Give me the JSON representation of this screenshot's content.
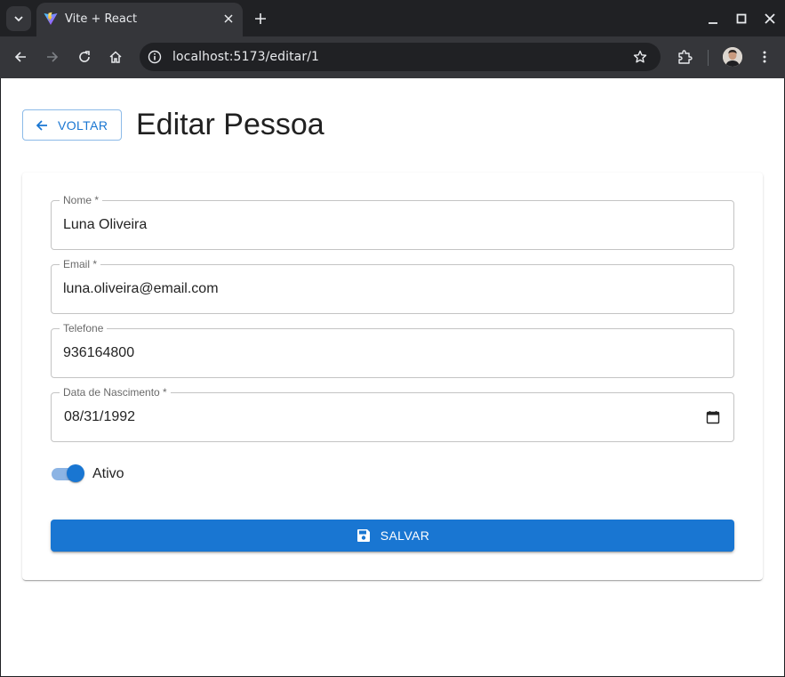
{
  "browser": {
    "tab_title": "Vite + React",
    "url": "localhost:5173/editar/1"
  },
  "page": {
    "back_label": "VOLTAR",
    "title": "Editar Pessoa"
  },
  "form": {
    "nome": {
      "label": "Nome *",
      "value": "Luna Oliveira"
    },
    "email": {
      "label": "Email *",
      "value": "luna.oliveira@email.com"
    },
    "telefone": {
      "label": "Telefone",
      "value": "936164800"
    },
    "nascimento": {
      "label": "Data de Nascimento *",
      "value": "08/31/1992"
    },
    "ativo": {
      "label": "Ativo",
      "checked": true
    },
    "save_label": "SALVAR"
  },
  "colors": {
    "primary": "#1976d2",
    "chrome_dark": "#202124",
    "chrome_toolbar": "#35363a"
  }
}
